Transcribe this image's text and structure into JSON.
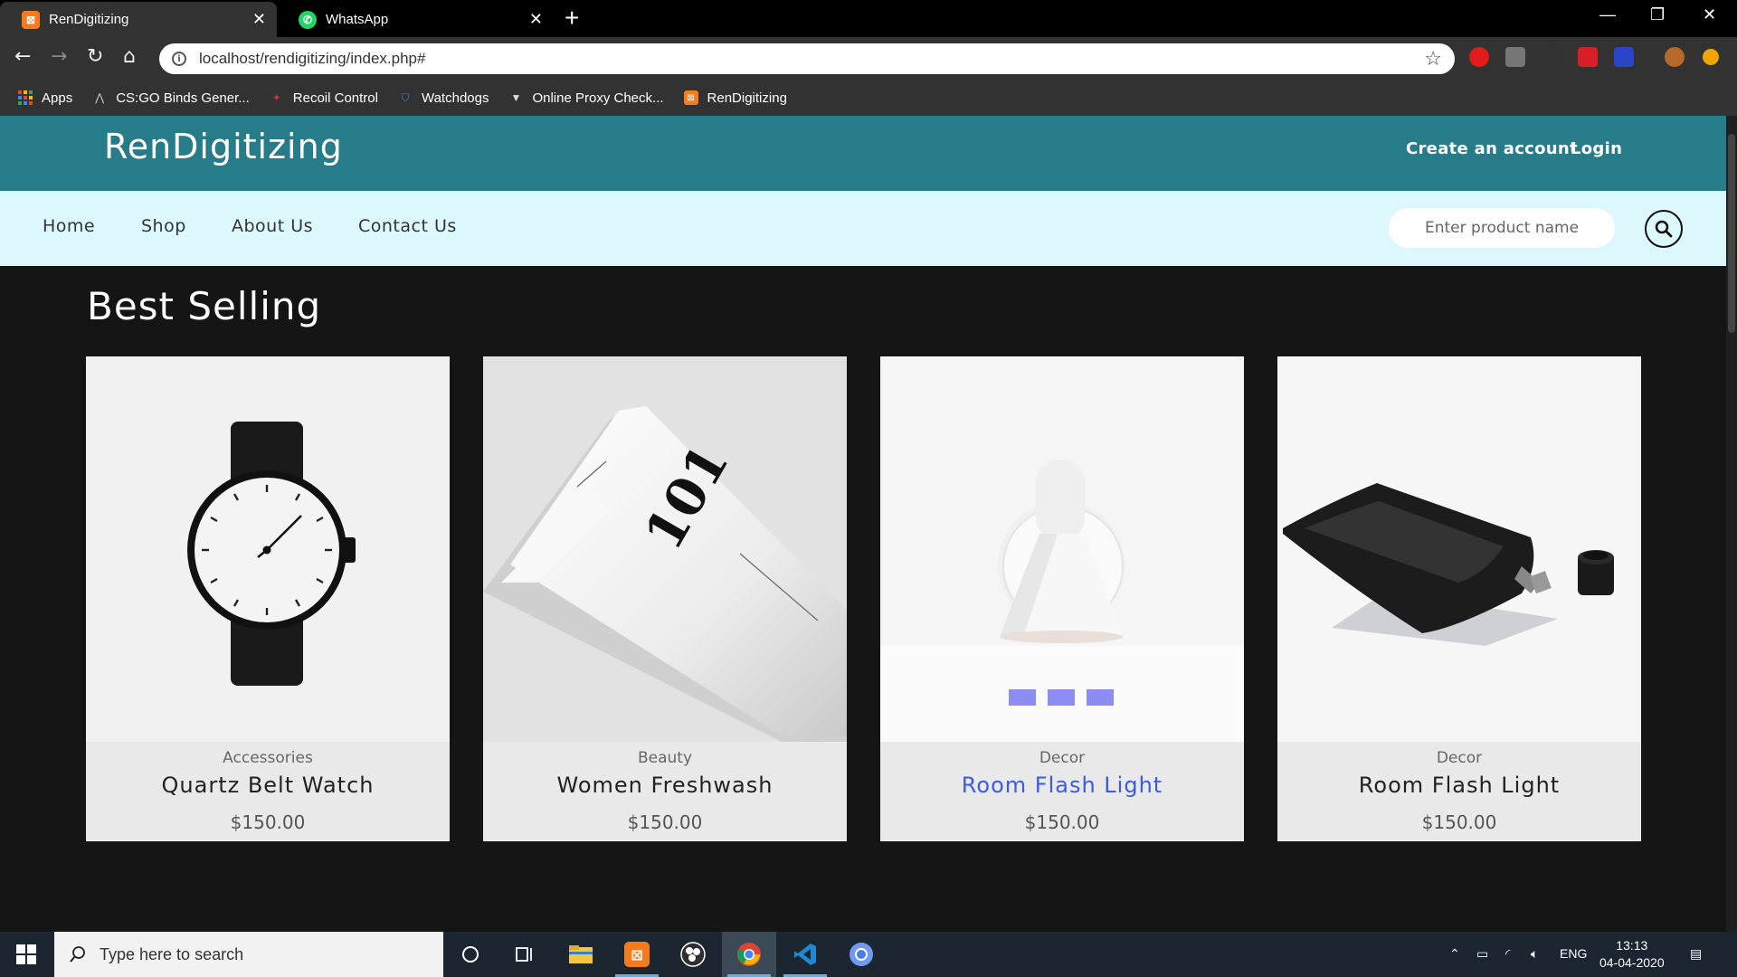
{
  "browser": {
    "tabs": [
      {
        "title": "RenDigitizing",
        "icon": "xampp-icon",
        "active": true
      },
      {
        "title": "WhatsApp",
        "icon": "whatsapp-icon",
        "active": false
      }
    ],
    "url": "localhost/rendigitizing/index.php#",
    "bookmarks": [
      {
        "label": "Apps",
        "icon": "apps-grid-icon"
      },
      {
        "label": "CS:GO Binds Gener...",
        "icon": "csgo-icon"
      },
      {
        "label": "Recoil Control",
        "icon": "recoil-icon"
      },
      {
        "label": "Watchdogs",
        "icon": "shield-icon"
      },
      {
        "label": "Online Proxy Check...",
        "icon": "proxy-icon"
      },
      {
        "label": "RenDigitizing",
        "icon": "xampp-icon"
      }
    ]
  },
  "site": {
    "brand": "RenDigitizing",
    "header_links": {
      "create_account": "Create an account",
      "login": "Login"
    },
    "nav": [
      "Home",
      "Shop",
      "About Us",
      "Contact Us"
    ],
    "search_placeholder": "Enter product name",
    "section_title": "Best Selling",
    "products": [
      {
        "category": "Accessories",
        "name": "Quartz Belt Watch",
        "price": "$150.00",
        "image": "watch"
      },
      {
        "category": "Beauty",
        "name": "Women Freshwash",
        "price": "$150.00",
        "image": "tube"
      },
      {
        "category": "Decor",
        "name": "Room Flash Light",
        "price": "$150.00",
        "image": "lamp",
        "highlighted": true
      },
      {
        "category": "Decor",
        "name": "Room Flash Light",
        "price": "$150.00",
        "image": "pouch"
      }
    ],
    "tube_print": "101",
    "colors": {
      "header": "#267c89",
      "nav": "#dcf8fc",
      "page": "#151515",
      "highlight": "#3d5be0"
    }
  },
  "taskbar": {
    "search_placeholder": "Type here to search",
    "language": "ENG",
    "time": "13:13",
    "date": "04-04-2020"
  }
}
